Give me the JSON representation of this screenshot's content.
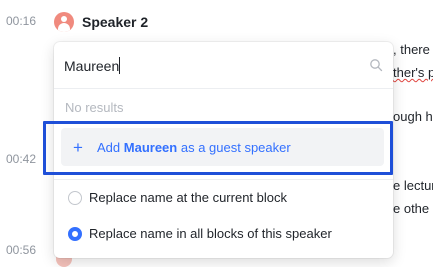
{
  "transcript": {
    "timestamps": [
      "00:16",
      "00:42",
      "00:56"
    ],
    "speaker": {
      "name": "Speaker 2",
      "avatar_color": "#f08a7e"
    },
    "background_fragments": [
      ", there",
      "ther's p",
      "ough his",
      "e lectur",
      "e othe"
    ]
  },
  "speaker_dropdown": {
    "search": {
      "value": "Maureen",
      "placeholder": ""
    },
    "no_results_text": "No results",
    "add_guest": {
      "prefix": "Add",
      "name": "Maureen",
      "suffix": "as a guest speaker"
    },
    "options": [
      {
        "label": "Replace name at the current block",
        "selected": false
      },
      {
        "label": "Replace name in all blocks of this speaker",
        "selected": true
      }
    ]
  },
  "colors": {
    "accent": "#3370ff",
    "highlight_border": "#1e4fd8",
    "muted_text": "#8f959e",
    "spellcheck": "#e0443e"
  },
  "icons": {
    "search": "search-icon",
    "add": "plus-icon",
    "avatar": "user-avatar-icon"
  }
}
